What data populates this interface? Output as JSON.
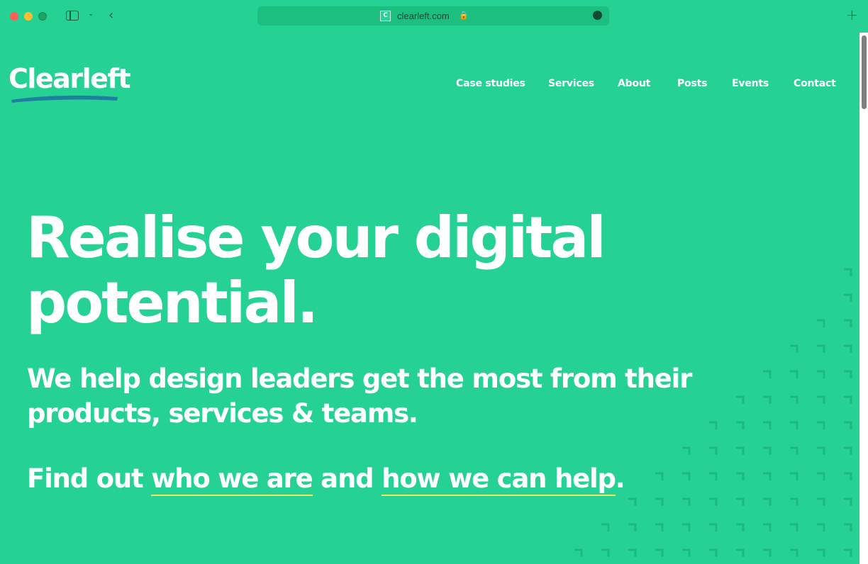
{
  "browser": {
    "url": "clearleft.com",
    "favicon_letter": "C",
    "lock_glyph": "🔒"
  },
  "site": {
    "logo_text": "Clearleft",
    "nav": [
      {
        "label": "Case studies"
      },
      {
        "label": "Services"
      },
      {
        "label": "About"
      },
      {
        "label": "Posts"
      },
      {
        "label": "Events"
      },
      {
        "label": "Contact"
      }
    ]
  },
  "hero": {
    "headline": "Realise your digital potential.",
    "subheadline": "We help design leaders get the most from their products, services & teams.",
    "cta_prefix": "Find out ",
    "cta_link1": "who we are",
    "cta_middle": " and ",
    "cta_link2": "how we can help",
    "cta_suffix": "."
  },
  "colors": {
    "background": "#25d293",
    "text": "#ffffff",
    "link_underline": "#f3e469",
    "logo_swoosh": "#1f7fa0",
    "pattern": "#1cb87f"
  },
  "icons": {
    "sidebar": "sidebar-icon",
    "back": "chevron-left-icon",
    "new_tab": "plus-icon",
    "lock": "lock-icon",
    "site_settings": "globe-icon"
  }
}
